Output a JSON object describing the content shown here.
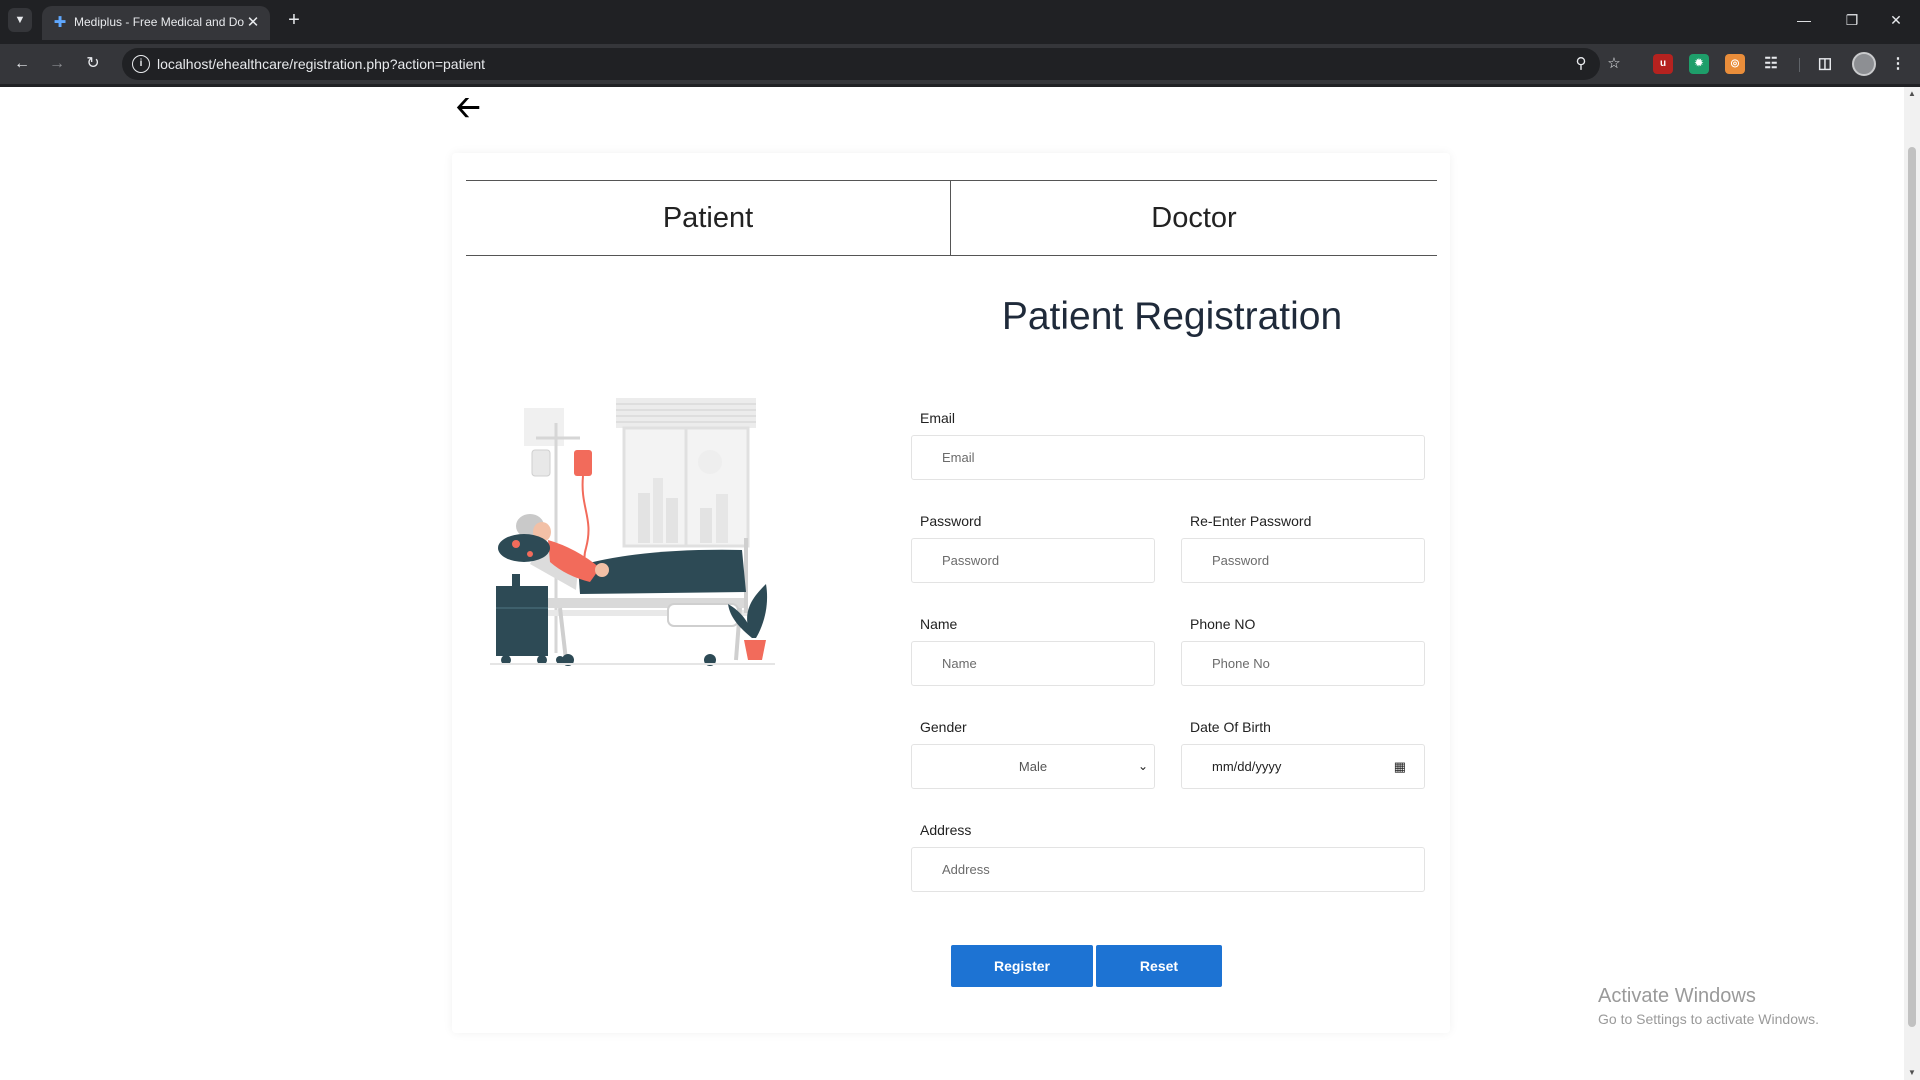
{
  "browser": {
    "tab_title": "Mediplus - Free Medical and Do",
    "url": "localhost/ehealthcare/registration.php?action=patient"
  },
  "role_tabs": {
    "patient": "Patient",
    "doctor": "Doctor"
  },
  "form": {
    "title": "Patient Registration",
    "email": {
      "label": "Email",
      "placeholder": "Email"
    },
    "password": {
      "label": "Password",
      "placeholder": "Password"
    },
    "reenter_password": {
      "label": "Re-Enter Password",
      "placeholder": "Password"
    },
    "name": {
      "label": "Name",
      "placeholder": "Name"
    },
    "phone": {
      "label": "Phone NO",
      "placeholder": "Phone No"
    },
    "gender": {
      "label": "Gender",
      "value": "Male"
    },
    "dob": {
      "label": "Date Of Birth",
      "value": "mm/dd/yyyy"
    },
    "address": {
      "label": "Address",
      "placeholder": "Address"
    },
    "register_label": "Register",
    "reset_label": "Reset"
  },
  "watermark": {
    "title": "Activate Windows",
    "subtitle": "Go to Settings to activate Windows."
  },
  "colors": {
    "primary_button": "#1d73d3",
    "title_text": "#1f2a3a",
    "illustration_accent": "#f26b5b",
    "illustration_dark": "#2d4a55"
  },
  "icons": {
    "back": "arrow-left-icon",
    "favicon": "medical-cross-icon"
  }
}
